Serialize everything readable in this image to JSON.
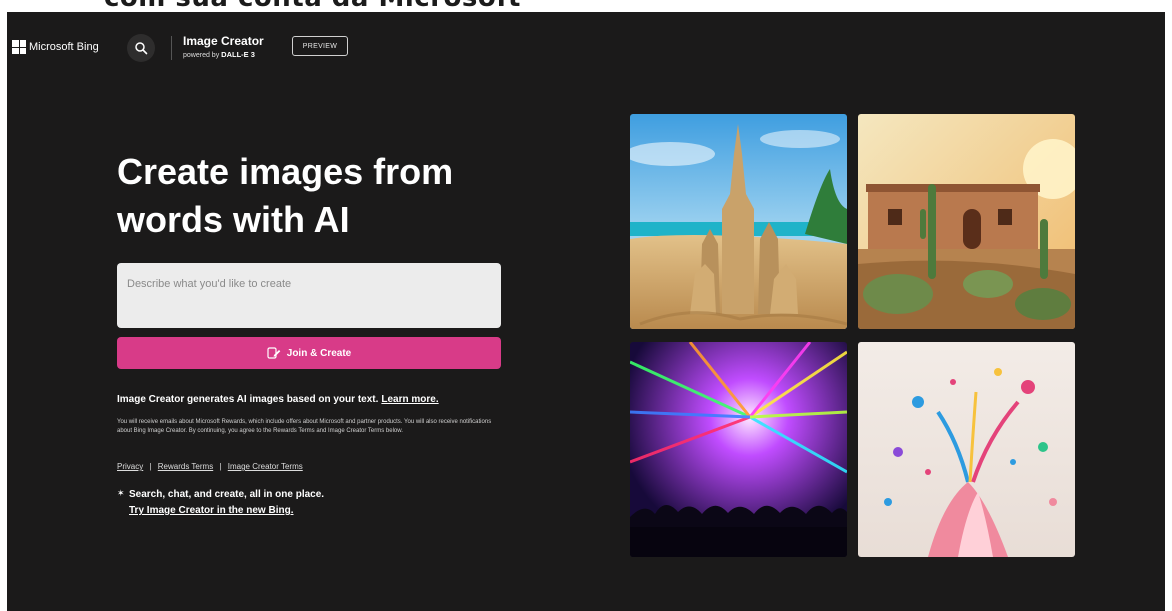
{
  "caption": "com sua conta da Microsoft",
  "header": {
    "logo_text": "Microsoft Bing",
    "app_title": "Image Creator",
    "powered_by": "powered by",
    "model": "DALL-E 3",
    "badge": "PREVIEW"
  },
  "hero": {
    "title_line1": "Create images from",
    "title_line2": "words with AI"
  },
  "prompt": {
    "placeholder": "Describe what you'd like to create"
  },
  "join_button": {
    "label": "Join & Create"
  },
  "info": {
    "text": "Image Creator generates AI images based on your text.",
    "learn_more": "Learn more.",
    "fine_print": "You will receive emails about Microsoft Rewards, which include offers about Microsoft and partner products. You will also receive notifications about Bing Image Creator. By continuing, you agree to the Rewards Terms and Image Creator Terms below."
  },
  "terms": {
    "privacy": "Privacy",
    "separator": "|",
    "rewards_terms": "Rewards Terms",
    "creator_terms": "Image Creator Terms"
  },
  "promo": {
    "text": "Search, chat, and create, all in one place.",
    "link": "Try Image Creator in the new Bing."
  },
  "gallery": [
    "sandcastle-beach",
    "desert-house-cacti",
    "concert-lasers",
    "paint-splash"
  ],
  "colors": {
    "background": "#1b1a1a",
    "accent": "#d83b88",
    "input_bg": "#ececec"
  }
}
